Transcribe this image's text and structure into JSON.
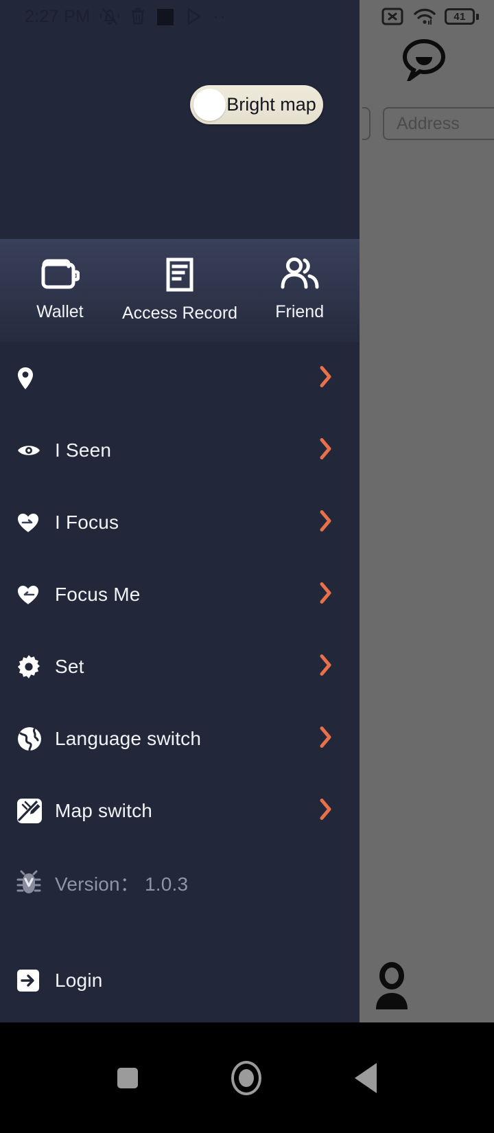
{
  "status_bar": {
    "time": "2:27 PM",
    "left_icons": [
      "bell-mute-icon",
      "trash-icon",
      "square-icon",
      "play-store-icon"
    ],
    "overflow_dots": "··"
  },
  "backdrop_status_bar": {
    "sim_icon": "sim-card-x-icon",
    "wifi_icon": "wifi-icon",
    "battery_level": "41"
  },
  "backdrop": {
    "avatar_icon": "chat-bubble-face-icon",
    "address_field_placeholder": "Address",
    "person_icon": "person-icon"
  },
  "toggle": {
    "label": "Bright map",
    "state": "off"
  },
  "shortcuts": [
    {
      "label": "Wallet",
      "icon": "wallet-icon"
    },
    {
      "label": "Access Record",
      "icon": "document-lines-icon"
    },
    {
      "label": "Friend",
      "icon": "people-icon"
    }
  ],
  "menu": [
    {
      "label": "",
      "icon": "location-pin-icon",
      "chevron": true
    },
    {
      "label": "I Seen",
      "icon": "eye-icon",
      "chevron": true
    },
    {
      "label": "I Focus",
      "icon": "heart-icon",
      "chevron": true
    },
    {
      "label": "Focus Me",
      "icon": "heart-icon",
      "chevron": true
    },
    {
      "label": "Set",
      "icon": "gear-icon",
      "chevron": true
    },
    {
      "label": "Language switch",
      "icon": "globe-icon",
      "chevron": true
    },
    {
      "label": "Map switch",
      "icon": "map-edit-icon",
      "chevron": true
    },
    {
      "label": "Version： 1.0.3",
      "icon": "bug-icon",
      "chevron": false
    }
  ],
  "login": {
    "label": "Login",
    "icon": "login-arrow-icon"
  },
  "navbar": {
    "recents": "square-icon",
    "home": "circle-icon",
    "back": "triangle-back-icon"
  },
  "colors": {
    "drawer_bg": "#222739",
    "strip_top": "#39405a",
    "chevron": "#e8714a",
    "toggle_bg": "#ebe6d6",
    "text": "#f2f3f6",
    "muted_text": "#8e95a6",
    "backdrop_dim": "#6b6b6b"
  }
}
